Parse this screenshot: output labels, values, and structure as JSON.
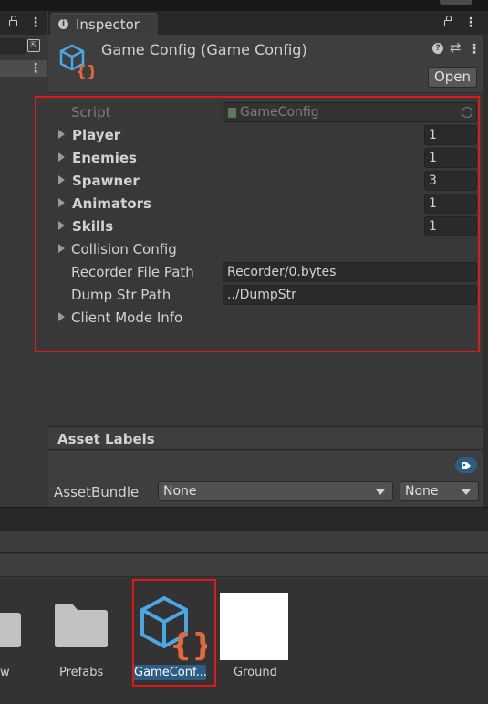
{
  "inspector": {
    "tab_label": "Inspector",
    "object_title": "Game Config (Game Config)",
    "open_button": "Open",
    "header_icons": [
      "help-icon",
      "presets-icon",
      "kebab-icon"
    ],
    "fields": {
      "script_label": "Script",
      "script_value": "GameConfig",
      "player_label": "Player",
      "player_value": "1",
      "enemies_label": "Enemies",
      "enemies_value": "1",
      "spawner_label": "Spawner",
      "spawner_value": "3",
      "animators_label": "Animators",
      "animators_value": "1",
      "skills_label": "Skills",
      "skills_value": "1",
      "collision_label": "Collision Config",
      "recorder_label": "Recorder File Path",
      "recorder_value": "Recorder/0.bytes",
      "dump_label": "Dump Str Path",
      "dump_value": "../DumpStr",
      "client_label": "Client Mode Info"
    },
    "asset_labels": {
      "title": "Asset Labels",
      "assetbundle_label": "AssetBundle",
      "assetbundle_value": "None",
      "variant_value": "None"
    }
  },
  "project": {
    "items": [
      {
        "label": "w"
      },
      {
        "label": "Prefabs"
      },
      {
        "label": "GameConf..."
      },
      {
        "label": "Ground"
      }
    ]
  },
  "colors": {
    "highlight": "#e01818",
    "selection": "#2c5d87",
    "asset_icon_blue": "#4aa8e6",
    "asset_icon_orange": "#e0683a"
  }
}
